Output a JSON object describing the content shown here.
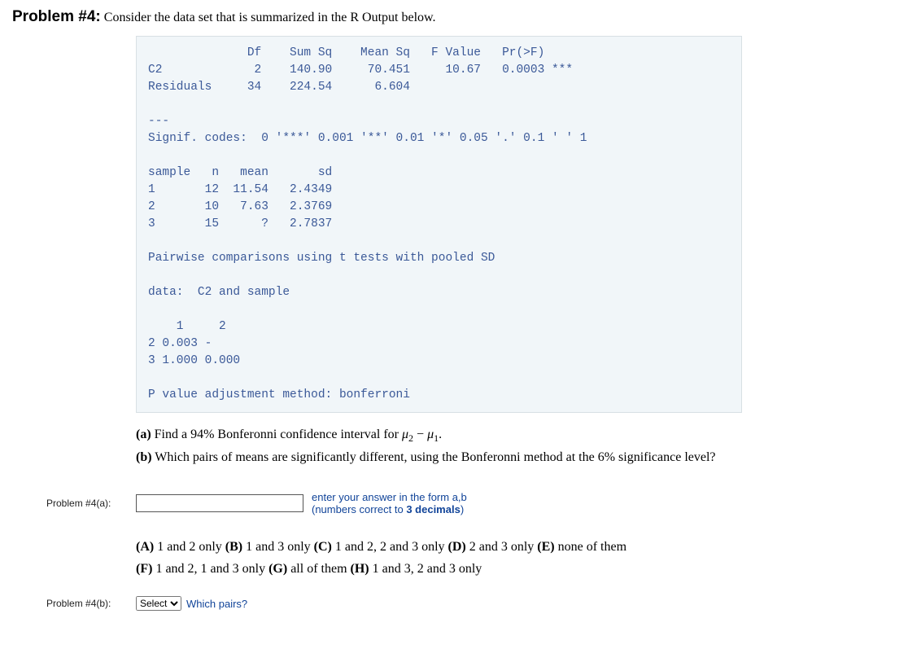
{
  "header": {
    "problem_label": "Problem #4:",
    "intro": "Consider the data set that is summarized in the R Output below."
  },
  "code": {
    "anova_header": "              Df    Sum Sq    Mean Sq   F Value   Pr(>F)",
    "anova_c2": "C2             2    140.90     70.451     10.67   0.0003 ***",
    "anova_res": "Residuals     34    224.54      6.604",
    "blank1": "",
    "sep": "---",
    "signif": "Signif. codes:  0 '***' 0.001 '**' 0.01 '*' 0.05 '.' 0.1 ' ' 1",
    "blank2": "",
    "sample_hdr": "sample   n   mean       sd",
    "sample_1": "1       12  11.54   2.4349",
    "sample_2": "2       10   7.63   2.3769",
    "sample_3": "3       15      ?   2.7837",
    "blank3": "",
    "pairwise": "Pairwise comparisons using t tests with pooled SD",
    "blank4": "",
    "data_line": "data:  C2 and sample",
    "blank5": "",
    "mat_hdr": "    1     2",
    "mat_r2": "2 0.003 -",
    "mat_r3": "3 1.000 0.000",
    "blank6": "",
    "adjust": "P value adjustment method: bonferroni"
  },
  "parts": {
    "a_label": "(a)",
    "a_text": " Find a 94% Bonferonni confidence interval for ",
    "a_end": ".",
    "b_label": "(b)",
    "b_text": " Which pairs of means are significantly different, using the Bonferonni method at the 6% significance level?"
  },
  "answer_a": {
    "label": "Problem #4(a):",
    "hint1": "enter your answer in the form a,b",
    "hint2": "(numbers correct to ",
    "hint2b": "3 decimals",
    "hint2c": ")"
  },
  "options": {
    "A": "(A)",
    "A_text": " 1 and 2 only   ",
    "B": "(B)",
    "B_text": " 1 and 3 only   ",
    "C": "(C)",
    "C_text": " 1 and 2, 2 and 3 only   ",
    "D": "(D)",
    "D_text": " 2 and 3 only   ",
    "E": "(E)",
    "E_text": " none of them",
    "F": "(F)",
    "F_text": " 1 and 2, 1 and 3 only   ",
    "G": "(G)",
    "G_text": " all of them   ",
    "H": "(H)",
    "H_text": " 1 and 3, 2 and 3 only"
  },
  "answer_b": {
    "label": "Problem #4(b):",
    "select_value": "Select",
    "hint": "Which pairs?"
  }
}
